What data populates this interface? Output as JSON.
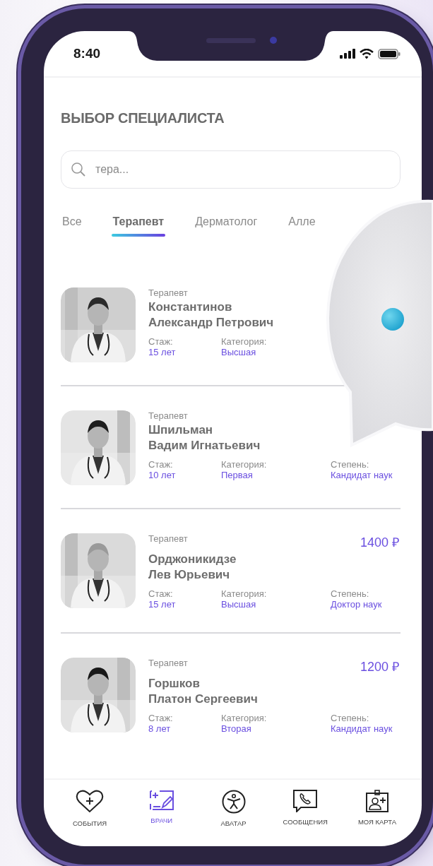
{
  "status_bar": {
    "time": "8:40"
  },
  "title": "ВЫБОР СПЕЦИАЛИСТА",
  "search": {
    "value": "тера..."
  },
  "tabs": [
    {
      "label": "Все",
      "selected": false
    },
    {
      "label": "Терапевт",
      "selected": true
    },
    {
      "label": "Дерматолог",
      "selected": false
    },
    {
      "label": "Алле",
      "selected": false
    }
  ],
  "doctors": [
    {
      "specialty": "Терапевт",
      "surname": "Константинов",
      "given_names": "Александр Петрович",
      "experience_label": "Стаж:",
      "experience": "15 лет",
      "category_label": "Категория:",
      "category": "Высшая"
    },
    {
      "specialty": "Терапевт",
      "surname": "Шпильман",
      "given_names": "Вадим Игнатьевич",
      "experience_label": "Стаж:",
      "experience": "10 лет",
      "category_label": "Категория:",
      "category": "Первая",
      "degree_label": "Степень:",
      "degree": "Кандидат наук"
    },
    {
      "specialty": "Терапевт",
      "surname": "Орджоникидзе",
      "given_names": "Лев Юрьевич",
      "experience_label": "Стаж:",
      "experience": "15 лет",
      "category_label": "Категория:",
      "category": "Высшая",
      "degree_label": "Степень:",
      "degree": "Доктор наук",
      "price": "1400 ₽"
    },
    {
      "specialty": "Терапевт",
      "surname": "Горшков",
      "given_names": "Платон Сергеевич",
      "experience_label": "Стаж:",
      "experience": "8 лет",
      "category_label": "Категория:",
      "category": "Вторая",
      "degree_label": "Степень:",
      "degree": "Кандидат наук",
      "price": "1200 ₽"
    }
  ],
  "nav": [
    {
      "label": "СОБЫТИЯ",
      "selected": false
    },
    {
      "label": "ВРАЧИ",
      "selected": true
    },
    {
      "label": "АВАТАР",
      "selected": false
    },
    {
      "label": "СООБЩЕНИЯ",
      "selected": false
    },
    {
      "label": "МОЯ КАРТА",
      "selected": false
    }
  ]
}
